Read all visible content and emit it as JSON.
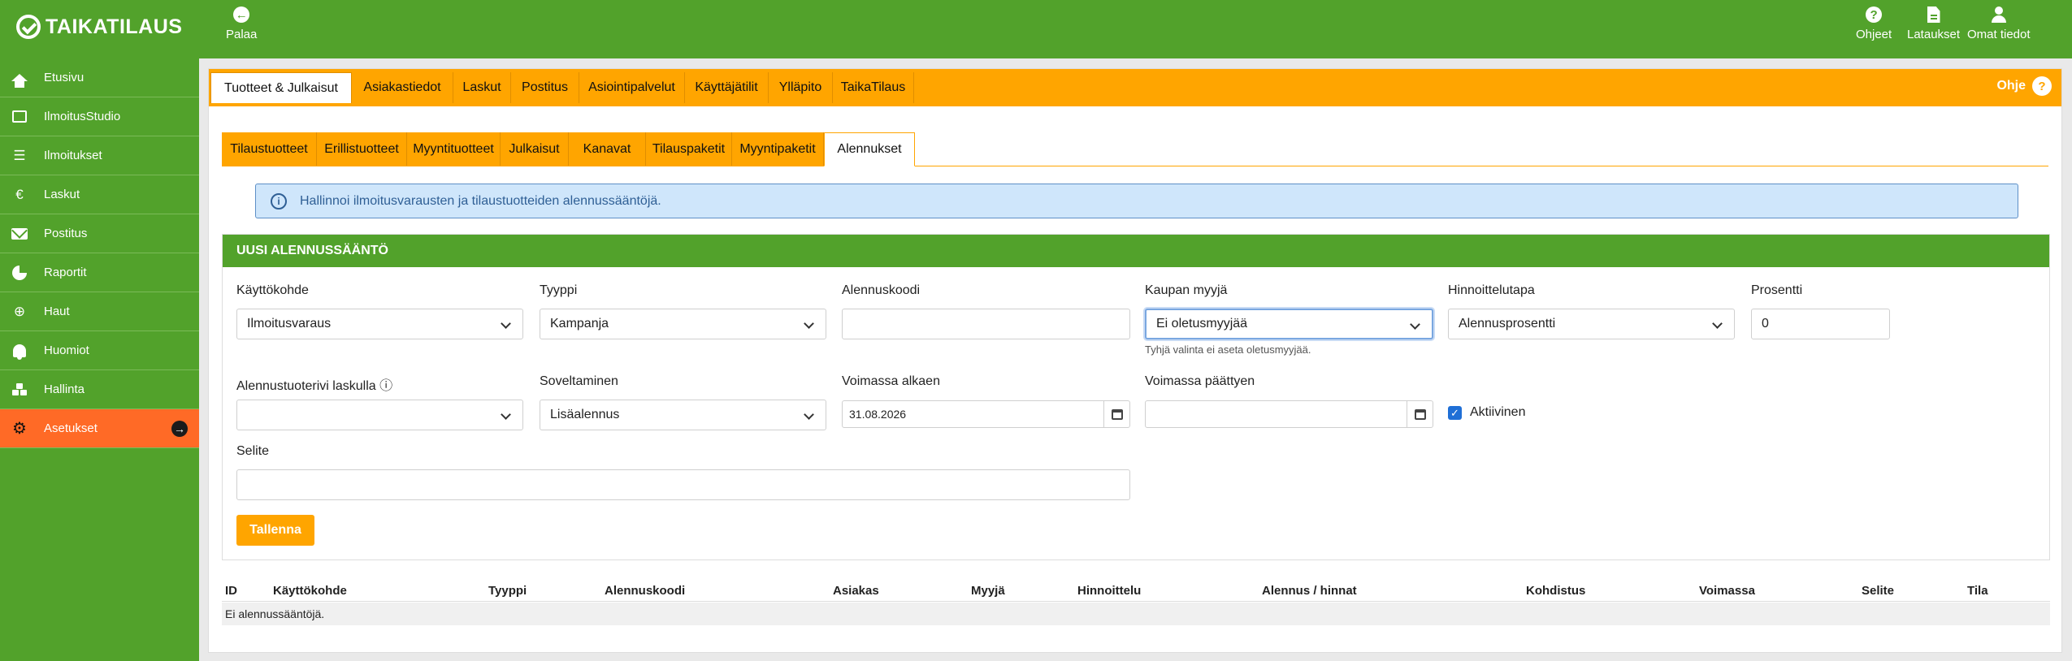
{
  "app": {
    "brand": "TAIKATILAUS"
  },
  "topbar": {
    "back_label": "Palaa",
    "actions": [
      {
        "label": "Ohjeet",
        "icon": "question-circle-icon"
      },
      {
        "label": "Lataukset",
        "icon": "document-icon"
      },
      {
        "label": "Omat tiedot",
        "icon": "user-icon"
      }
    ]
  },
  "sidebar": {
    "items": [
      {
        "label": "Etusivu",
        "icon": "home-icon"
      },
      {
        "label": "IlmoitusStudio",
        "icon": "newspaper-icon"
      },
      {
        "label": "Ilmoitukset",
        "icon": "list-indent-icon"
      },
      {
        "label": "Laskut",
        "icon": "euro-icon"
      },
      {
        "label": "Postitus",
        "icon": "envelope-icon"
      },
      {
        "label": "Raportit",
        "icon": "pie-chart-icon"
      },
      {
        "label": "Haut",
        "icon": "search-plus-icon"
      },
      {
        "label": "Huomiot",
        "icon": "bell-icon"
      },
      {
        "label": "Hallinta",
        "icon": "cubes-icon"
      },
      {
        "label": "Asetukset",
        "icon": "gear-icon",
        "active": true
      }
    ]
  },
  "main_tabs": [
    "Tuotteet & Julkaisut",
    "Asiakastiedot",
    "Laskut",
    "Postitus",
    "Asiointipalvelut",
    "Käyttäjätilit",
    "Ylläpito",
    "TaikaTilaus"
  ],
  "help_label": "Ohje",
  "sub_tabs": [
    "Tilaustuotteet",
    "Erillistuotteet",
    "Myyntituotteet",
    "Julkaisut",
    "Kanavat",
    "Tilauspaketit",
    "Myyntipaketit",
    "Alennukset"
  ],
  "info_text": "Hallinnoi ilmoitusvarausten ja tilaustuotteiden alennussääntöjä.",
  "form": {
    "title": "UUSI ALENNUSSÄÄNTÖ",
    "kayttokohde": {
      "label": "Käyttökohde",
      "value": "Ilmoitusvaraus"
    },
    "tyyppi": {
      "label": "Tyyppi",
      "value": "Kampanja"
    },
    "alennuskoodi": {
      "label": "Alennuskoodi",
      "value": ""
    },
    "kaupan_myyja": {
      "label": "Kaupan myyjä",
      "value": "Ei oletusmyyjää",
      "help": "Tyhjä valinta ei aseta oletusmyyjää."
    },
    "hinnoittelutapa": {
      "label": "Hinnoittelutapa",
      "value": "Alennusprosentti"
    },
    "prosentti": {
      "label": "Prosentti",
      "value": "0"
    },
    "alennustuoterivi": {
      "label": "Alennustuoterivi laskulla ⓘ",
      "value": ""
    },
    "soveltaminen": {
      "label": "Soveltaminen",
      "value": "Lisäalennus"
    },
    "voimassa_alkaen": {
      "label": "Voimassa alkaen",
      "value": "31.08.2026"
    },
    "voimassa_paattyen": {
      "label": "Voimassa päättyen",
      "value": ""
    },
    "aktiivinen": {
      "label": "Aktiivinen",
      "checked": true
    },
    "selite": {
      "label": "Selite",
      "value": ""
    },
    "save_label": "Tallenna"
  },
  "table": {
    "columns": [
      "ID",
      "Käyttökohde",
      "Tyyppi",
      "Alennuskoodi",
      "Asiakas",
      "Myyjä",
      "Hinnoittelu",
      "Alennus / hinnat",
      "Kohdistus",
      "Voimassa",
      "Selite",
      "Tila"
    ],
    "empty_text": "Ei alennussääntöjä."
  },
  "colors": {
    "green": "#52a22b",
    "orange": "#ffa500",
    "active_sidebar": "#ff6a26",
    "info_bg": "#cfe6fb"
  }
}
